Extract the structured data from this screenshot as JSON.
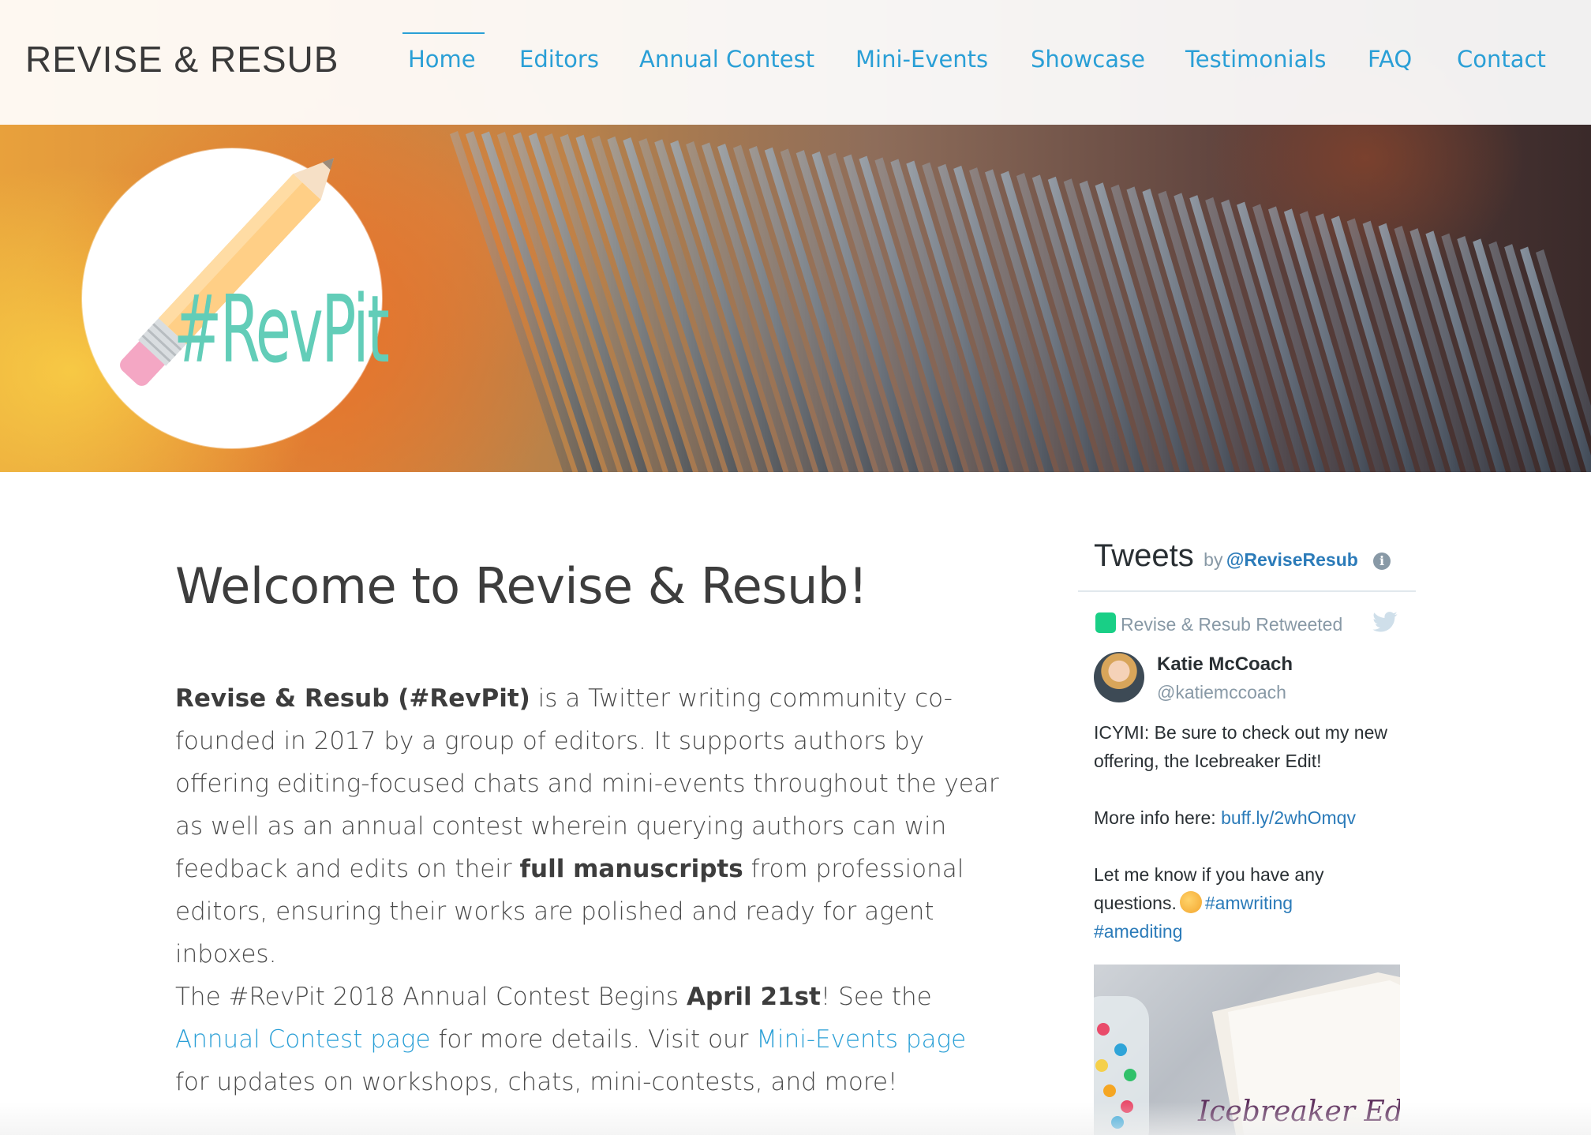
{
  "header": {
    "site_title": "REVISE & RESUB",
    "nav": [
      {
        "label": "Home",
        "active": true
      },
      {
        "label": "Editors"
      },
      {
        "label": "Annual Contest"
      },
      {
        "label": "Mini-Events"
      },
      {
        "label": "Showcase"
      },
      {
        "label": "Testimonials"
      },
      {
        "label": "FAQ"
      },
      {
        "label": "Contact"
      }
    ]
  },
  "hero": {
    "logo_text": "#RevPit",
    "logo_icon": "pencil-icon"
  },
  "main": {
    "title": "Welcome to Revise & Resub!",
    "para1": {
      "bold_intro": "Revise & Resub (#RevPit)",
      "text_a": " is a Twitter writing community co-founded in 2017 by a group of editors. It supports authors by offering editing-focused chats and mini-events throughout the year as well as an annual contest wherein querying authors can win feedback and edits on their ",
      "bold_mid": "full manuscripts",
      "text_b": " from professional editors, ensuring their works are polished and ready for agent inboxes."
    },
    "para2": {
      "text_a": "The #RevPit 2018 Annual Contest Begins ",
      "bold_date": "April 21st",
      "text_b": "! See the ",
      "link_annual": "Annual Contest page",
      "text_c": " for more details. Visit our ",
      "link_mini": "Mini-Events page",
      "text_d": " for updates on workshops, chats, mini-contests, and more!"
    }
  },
  "twitter": {
    "title": "Tweets",
    "by": "by",
    "handle": "@ReviseResub",
    "info_icon": "i",
    "retweet_label": "Revise & Resub Retweeted",
    "author_name": "Katie McCoach",
    "author_handle": "@katiemccoach",
    "tweet_line1": "ICYMI: Be sure to check out my new offering, the Icebreaker Edit!",
    "tweet_line2_text": "More info here: ",
    "tweet_line2_link": "buff.ly/2whOmqv",
    "tweet_line3_text": "Let me know if you have any questions.",
    "hashtag1": "#amwriting",
    "hashtag2": "#amediting",
    "media_caption": "Icebreaker Edit"
  },
  "colors": {
    "link": "#2a9fd6",
    "twitter_link": "#2b7bb9",
    "logo_teal": "#62cdb8",
    "retweet_green": "#19cf86"
  }
}
